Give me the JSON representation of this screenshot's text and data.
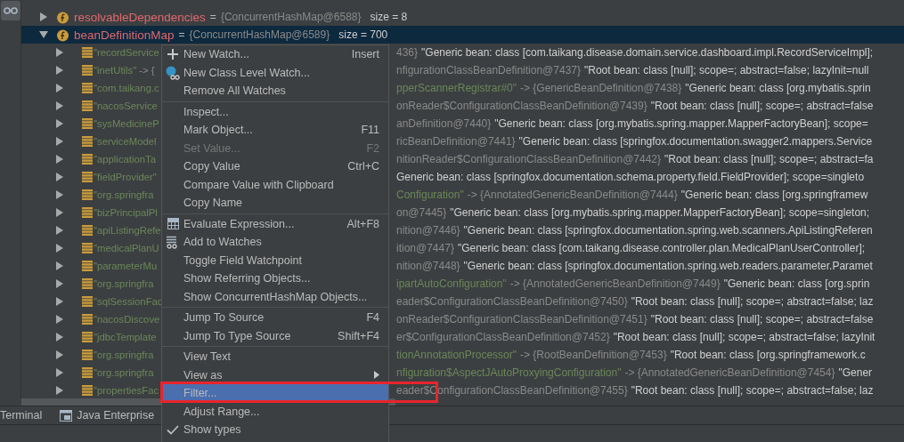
{
  "variables": [
    {
      "name": "resolvableDependencies",
      "operator": "=",
      "value": "{ConcurrentHashMap@6588}",
      "size": "size = 8",
      "expanded": false,
      "selected": false
    },
    {
      "name": "beanDefinitionMap",
      "operator": "=",
      "value": "{ConcurrentHashMap@6589}",
      "size": "size = 700",
      "expanded": true,
      "selected": true,
      "children": [
        {
          "expanded": false,
          "left": [
            {
              "kind": "key",
              "text": "\"recordService"
            }
          ],
          "right": [
            {
              "kind": "type",
              "text": "436}"
            },
            {
              "kind": "value",
              "text": "\"Generic bean: class [com.taikang.disease.domain.service.dashboard.impl.RecordServiceImpl];"
            }
          ]
        },
        {
          "expanded": false,
          "left": [
            {
              "kind": "key",
              "text": "\"inetUtils\""
            },
            {
              "kind": "type",
              "text": "-> {"
            }
          ],
          "right": [
            {
              "kind": "type",
              "text": "nfigurationClassBeanDefinition@7437}"
            },
            {
              "kind": "value",
              "text": "\"Root bean: class [null]; scope=; abstract=false; lazyInit=null"
            }
          ]
        },
        {
          "expanded": false,
          "left": [
            {
              "kind": "key",
              "text": "\"com.taikang.c"
            }
          ],
          "right": [
            {
              "kind": "key",
              "text": "pperScannerRegistrar#0\""
            },
            {
              "kind": "type",
              "text": "-> {GenericBeanDefinition@7438}"
            },
            {
              "kind": "value",
              "text": "\"Generic bean: class [org.mybatis.sprin"
            }
          ]
        },
        {
          "expanded": false,
          "left": [
            {
              "kind": "key",
              "text": "\"nacosService"
            }
          ],
          "right": [
            {
              "kind": "type",
              "text": "onReader$ConfigurationClassBeanDefinition@7439}"
            },
            {
              "kind": "value",
              "text": "\"Root bean: class [null]; scope=; abstract=false"
            }
          ]
        },
        {
          "expanded": false,
          "left": [
            {
              "kind": "key",
              "text": "\"sysMedicineP"
            }
          ],
          "right": [
            {
              "kind": "type",
              "text": "anDefinition@7440}"
            },
            {
              "kind": "value",
              "text": "\"Generic bean: class [org.mybatis.spring.mapper.MapperFactoryBean]; scope="
            }
          ]
        },
        {
          "expanded": false,
          "left": [
            {
              "kind": "key",
              "text": "\"serviceModel"
            }
          ],
          "right": [
            {
              "kind": "type",
              "text": "ricBeanDefinition@7441}"
            },
            {
              "kind": "value",
              "text": "\"Generic bean: class [springfox.documentation.swagger2.mappers.Service"
            }
          ]
        },
        {
          "expanded": false,
          "left": [
            {
              "kind": "key",
              "text": "\"applicationTa"
            }
          ],
          "right": [
            {
              "kind": "type",
              "text": "nitionReader$ConfigurationClassBeanDefinition@7442}"
            },
            {
              "kind": "value",
              "text": "\"Root bean: class [null]; scope=; abstract=fa"
            }
          ]
        },
        {
          "expanded": false,
          "left": [
            {
              "kind": "key",
              "text": "\"fieldProvider\""
            }
          ],
          "right": [
            {
              "kind": "value",
              "text": "Generic bean: class [springfox.documentation.schema.property.field.FieldProvider]; scope=singleto"
            }
          ]
        },
        {
          "expanded": false,
          "left": [
            {
              "kind": "key",
              "text": "\"org.springfra"
            }
          ],
          "right": [
            {
              "kind": "key",
              "text": "Configuration\""
            },
            {
              "kind": "type",
              "text": "-> {AnnotatedGenericBeanDefinition@7444}"
            },
            {
              "kind": "value",
              "text": "\"Generic bean: class [org.springframew"
            }
          ]
        },
        {
          "expanded": false,
          "left": [
            {
              "kind": "key",
              "text": "\"bizPrincipalPl"
            }
          ],
          "right": [
            {
              "kind": "type",
              "text": "on@7445}"
            },
            {
              "kind": "value",
              "text": "\"Generic bean: class [org.mybatis.spring.mapper.MapperFactoryBean]; scope=singleton;"
            }
          ]
        },
        {
          "expanded": false,
          "left": [
            {
              "kind": "key",
              "text": "\"apiListingRefe"
            }
          ],
          "right": [
            {
              "kind": "type",
              "text": "nition@7446}"
            },
            {
              "kind": "value",
              "text": "\"Generic bean: class [springfox.documentation.spring.web.scanners.ApiListingReferen"
            }
          ]
        },
        {
          "expanded": false,
          "left": [
            {
              "kind": "key",
              "text": "\"medicalPlanU"
            }
          ],
          "right": [
            {
              "kind": "type",
              "text": "ition@7447}"
            },
            {
              "kind": "value",
              "text": "\"Generic bean: class [com.taikang.disease.controller.plan.MedicalPlanUserController];"
            }
          ]
        },
        {
          "expanded": false,
          "left": [
            {
              "kind": "key",
              "text": "\"parameterMu"
            }
          ],
          "right": [
            {
              "kind": "type",
              "text": "nition@7448}"
            },
            {
              "kind": "value",
              "text": "\"Generic bean: class [springfox.documentation.spring.web.readers.parameter.Paramet"
            }
          ]
        },
        {
          "expanded": false,
          "left": [
            {
              "kind": "key",
              "text": "\"org.springfra"
            }
          ],
          "right": [
            {
              "kind": "key",
              "text": "ipartAutoConfiguration\""
            },
            {
              "kind": "type",
              "text": "-> {AnnotatedGenericBeanDefinition@7449}"
            },
            {
              "kind": "value",
              "text": "\"Generic bean: class [org.sprin"
            }
          ]
        },
        {
          "expanded": false,
          "left": [
            {
              "kind": "key",
              "text": "\"sqlSessionFac"
            }
          ],
          "right": [
            {
              "kind": "type",
              "text": "eader$ConfigurationClassBeanDefinition@7450}"
            },
            {
              "kind": "value",
              "text": "\"Root bean: class [null]; scope=; abstract=false; laz"
            }
          ]
        },
        {
          "expanded": false,
          "left": [
            {
              "kind": "key",
              "text": "\"nacosDiscove"
            }
          ],
          "right": [
            {
              "kind": "type",
              "text": "onReader$ConfigurationClassBeanDefinition@7451}"
            },
            {
              "kind": "value",
              "text": "\"Root bean: class [null]; scope=; abstract=false"
            }
          ]
        },
        {
          "expanded": false,
          "left": [
            {
              "kind": "key",
              "text": "\"jdbcTemplate"
            }
          ],
          "right": [
            {
              "kind": "type",
              "text": "er$ConfigurationClassBeanDefinition@7452}"
            },
            {
              "kind": "value",
              "text": "\"Root bean: class [null]; scope=; abstract=false; lazyInit"
            }
          ]
        },
        {
          "expanded": false,
          "left": [
            {
              "kind": "key",
              "text": "\"org.springfra"
            }
          ],
          "right": [
            {
              "kind": "key",
              "text": "tionAnnotationProcessor\""
            },
            {
              "kind": "type",
              "text": "-> {RootBeanDefinition@7453}"
            },
            {
              "kind": "value",
              "text": "\"Root bean: class [org.springframework.c"
            }
          ]
        },
        {
          "expanded": false,
          "left": [
            {
              "kind": "key",
              "text": "\"org.springfra"
            }
          ],
          "right": [
            {
              "kind": "key",
              "text": "nfiguration$AspectJAutoProxyingConfiguration\""
            },
            {
              "kind": "type",
              "text": "-> {AnnotatedGenericBeanDefinition@7454}"
            },
            {
              "kind": "value",
              "text": "\"Gener"
            }
          ]
        },
        {
          "expanded": false,
          "left": [
            {
              "kind": "key",
              "text": "\"propertiesFac"
            }
          ],
          "right": [
            {
              "kind": "type",
              "text": "eader$ConfigurationClassBeanDefinition@7455}"
            },
            {
              "kind": "value",
              "text": "\"Root bean: class [null]; scope=; abstract=false; laz"
            }
          ]
        }
      ]
    }
  ],
  "tool_tabs": [
    {
      "label": "Terminal",
      "kind": "plain"
    },
    {
      "label": "Java Enterprise",
      "kind": "enterprise"
    }
  ],
  "context_menu": {
    "items": [
      {
        "kind": "add",
        "label": "New Watch...",
        "shortcut": "Insert",
        "disabled": false,
        "selected": false
      },
      {
        "kind": "class-watch",
        "label": "New Class Level Watch...",
        "disabled": false,
        "selected": false
      },
      {
        "kind": "plain",
        "label": "Remove All Watches",
        "disabled": false,
        "selected": false
      },
      {
        "kind": "separator"
      },
      {
        "kind": "plain",
        "label": "Inspect...",
        "disabled": false,
        "selected": false
      },
      {
        "kind": "plain",
        "label": "Mark Object...",
        "shortcut": "F11",
        "disabled": false,
        "selected": false
      },
      {
        "kind": "plain",
        "label": "Set Value...",
        "shortcut": "F2",
        "disabled": true,
        "selected": false
      },
      {
        "kind": "plain",
        "label": "Copy Value",
        "shortcut": "Ctrl+C",
        "disabled": false,
        "selected": false
      },
      {
        "kind": "plain",
        "label": "Compare Value with Clipboard",
        "disabled": false,
        "selected": false
      },
      {
        "kind": "plain",
        "label": "Copy Name",
        "disabled": false,
        "selected": false
      },
      {
        "kind": "separator"
      },
      {
        "kind": "evaluate",
        "label": "Evaluate Expression...",
        "shortcut": "Alt+F8",
        "disabled": false,
        "selected": false
      },
      {
        "kind": "add-watch",
        "label": "Add to Watches",
        "disabled": false,
        "selected": false
      },
      {
        "kind": "plain",
        "label": "Toggle Field Watchpoint",
        "disabled": false,
        "selected": false
      },
      {
        "kind": "plain",
        "label": "Show Referring Objects...",
        "disabled": false,
        "selected": false
      },
      {
        "kind": "plain",
        "label": "Show ConcurrentHashMap Objects...",
        "disabled": false,
        "selected": false
      },
      {
        "kind": "separator"
      },
      {
        "kind": "plain",
        "label": "Jump To Source",
        "shortcut": "F4",
        "disabled": false,
        "selected": false
      },
      {
        "kind": "plain",
        "label": "Jump To Type Source",
        "shortcut": "Shift+F4",
        "disabled": false,
        "selected": false
      },
      {
        "kind": "separator"
      },
      {
        "kind": "plain",
        "label": "View Text",
        "disabled": false,
        "selected": false
      },
      {
        "kind": "submenu",
        "label": "View as",
        "disabled": false,
        "selected": false
      },
      {
        "kind": "plain",
        "label": "Filter...",
        "disabled": false,
        "selected": true
      },
      {
        "kind": "plain",
        "label": "Adjust Range...",
        "disabled": false,
        "selected": false
      },
      {
        "kind": "check",
        "label": "Show types",
        "checked": true,
        "disabled": false,
        "selected": false
      }
    ]
  }
}
